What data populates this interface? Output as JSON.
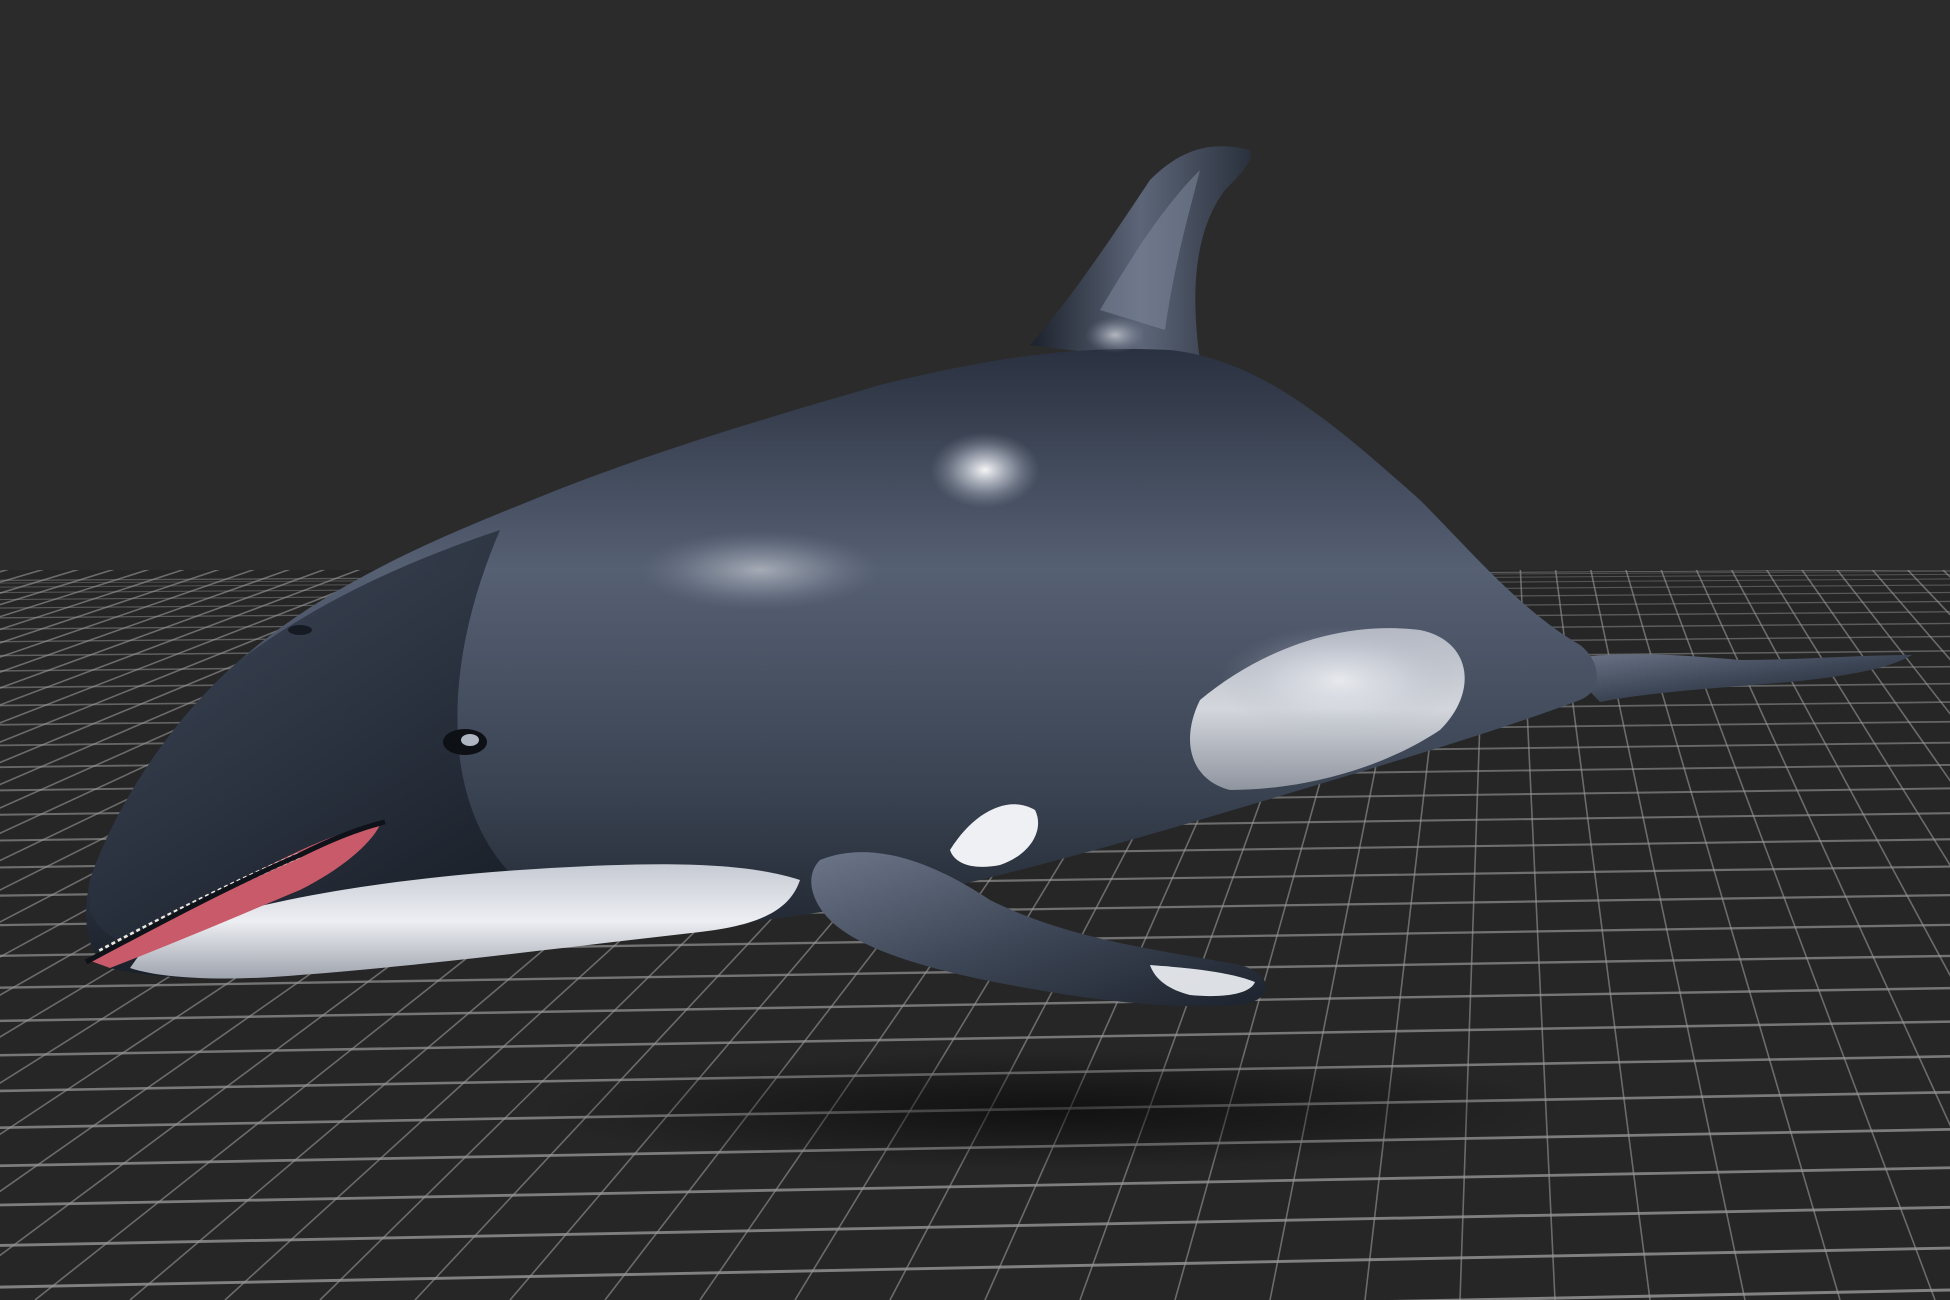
{
  "viewport": {
    "background_color": "#2b2b2b",
    "grid_color": "#9a9a9a",
    "grid_floor_color": "#262626",
    "show_grid": true
  },
  "model": {
    "subject": "dolphin-model",
    "body_dark_color": "#1e2530",
    "body_mid_color": "#4a5465",
    "belly_color": "#dfe2e8",
    "mouth_color": "#c95a6a",
    "highlight_color": "#f4f6fa"
  }
}
